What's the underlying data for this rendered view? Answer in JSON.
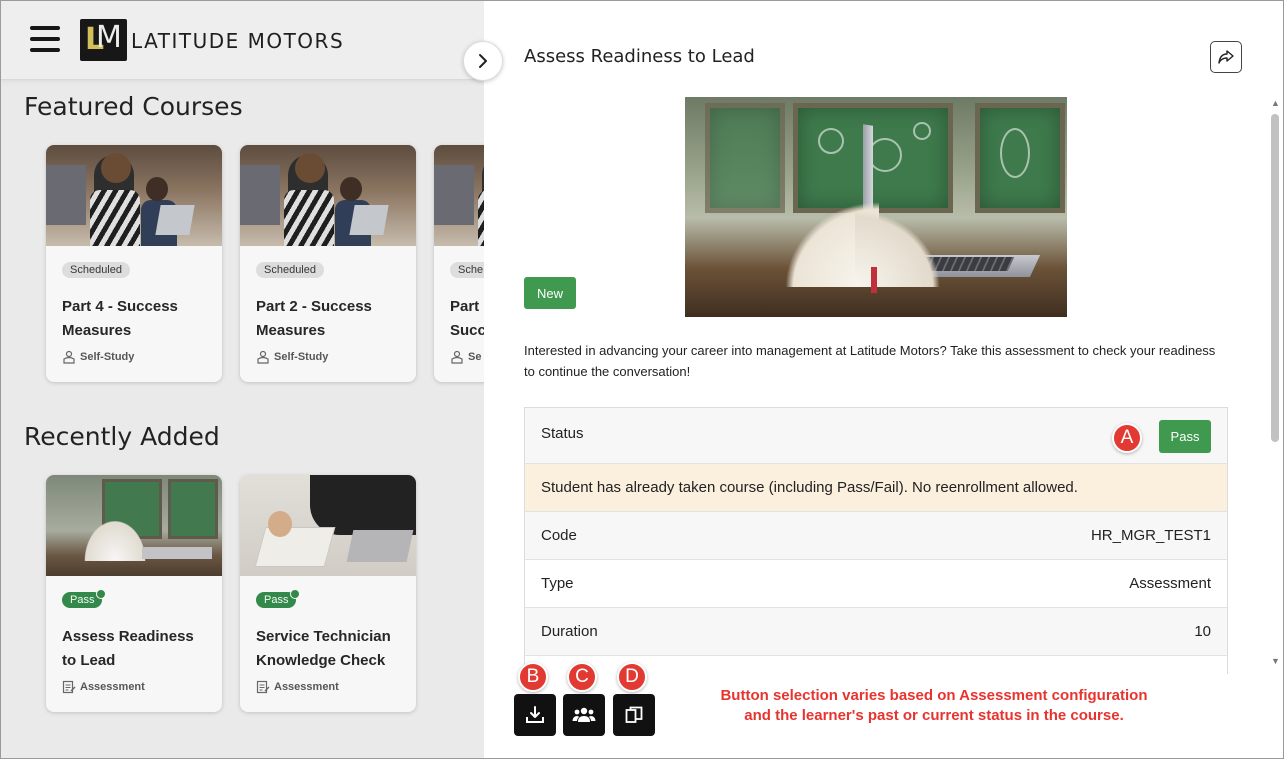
{
  "header": {
    "logo_letters_l": "L",
    "logo_letters_m": "M",
    "logo_text": "LATITUDE MOTORS"
  },
  "featured": {
    "title": "Featured Courses",
    "cards": [
      {
        "badge": "Scheduled",
        "title": "Part 4 - Success Measures",
        "type": "Self-Study"
      },
      {
        "badge": "Scheduled",
        "title": "Part 2 - Success Measures",
        "type": "Self-Study"
      },
      {
        "badge": "Sche",
        "title": "Part Succ",
        "type": "Se"
      }
    ]
  },
  "recent": {
    "title": "Recently Added",
    "cards": [
      {
        "badge": "Pass",
        "title": "Assess Readiness to Lead",
        "type": "Assessment"
      },
      {
        "badge": "Pass",
        "title": "Service Technician Knowledge Check",
        "type": "Assessment"
      }
    ]
  },
  "drawer": {
    "title": "Assess Readiness to Lead",
    "new_badge": "New",
    "description": "Interested in advancing your career into management at Latitude Motors? Take this assessment to check your readiness to continue the conversation!",
    "details": {
      "status_label": "Status",
      "status_value": "Pass",
      "warning": "Student has already taken course (including Pass/Fail). No reenrollment allowed.",
      "code_label": "Code",
      "code_value": "HR_MGR_TEST1",
      "type_label": "Type",
      "type_value": "Assessment",
      "duration_label": "Duration",
      "duration_value": "10"
    },
    "footer_note_line1": "Button selection varies based on Assessment configuration",
    "footer_note_line2": "and the learner's past or current status in the course."
  },
  "callouts": {
    "a": "A",
    "b": "B",
    "c": "C",
    "d": "D"
  },
  "icons": {
    "menu": "hamburger-menu-icon",
    "share": "share-icon",
    "chevron": "chevron-right-icon",
    "download": "download-icon",
    "group": "group-icon",
    "copy": "copy-icon"
  },
  "colors": {
    "pass_green": "#3f9a4f",
    "callout_red": "#e23a32",
    "warning_bg": "#fbefdd",
    "note_red": "#e8342f"
  }
}
